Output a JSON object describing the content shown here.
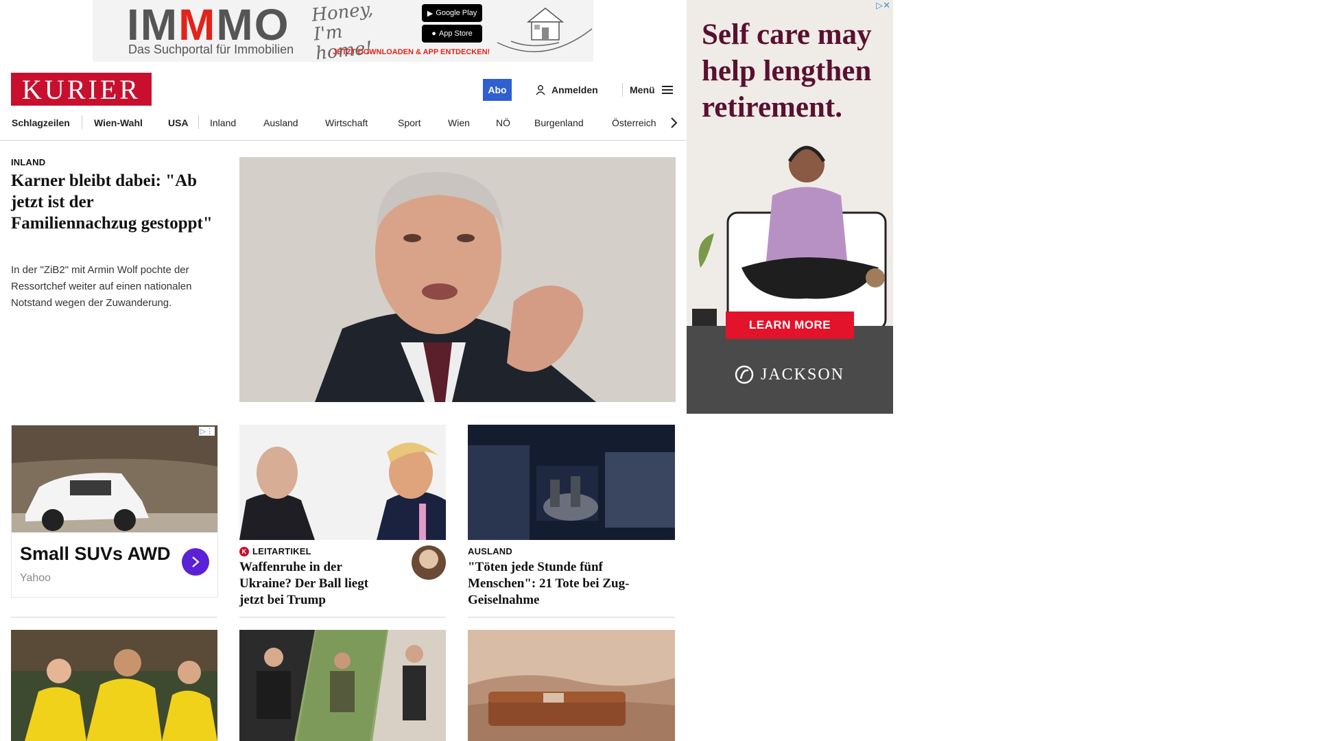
{
  "top_ad": {
    "brand_left": "IM",
    "brand_mid": "M",
    "brand_right": "MO",
    "tagline": "Das Suchportal für Immobilien",
    "script": "Honey, I'm home!",
    "google_play": "Google Play",
    "app_store": "App Store",
    "cta": "JETZT DOWNLOADEN & APP ENTDECKEN!"
  },
  "header": {
    "logo": "KURIER",
    "abo": "Abo",
    "login": "Anmelden",
    "menu": "Menü"
  },
  "nav": {
    "items": [
      "Schlagzeilen",
      "Wien-Wahl",
      "USA",
      "Inland",
      "Ausland",
      "Wirtschaft",
      "Sport",
      "Wien",
      "NÖ",
      "Burgenland",
      "Österreich"
    ]
  },
  "lead": {
    "kicker": "INLAND",
    "title": "Karner bleibt dabei: \"Ab jetzt ist der Familiennachzug gestoppt\"",
    "teaser": "In der \"ZiB2\" mit Armin Wolf pochte der Ressortchef weiter auf einen nationalen Notstand wegen der Zuwanderung."
  },
  "side_ad": {
    "headline": "Self care may help lengthen retirement.",
    "button": "LEARN MORE",
    "brand": "JACKSON"
  },
  "suv_ad": {
    "title": "Small SUVs AWD",
    "source": "Yahoo"
  },
  "articles": {
    "leitartikel": {
      "kicker": "LEITARTIKEL",
      "title": "Waffenruhe in der Ukraine? Der Ball liegt jetzt bei Trump"
    },
    "ausland": {
      "kicker": "AUSLAND",
      "title": "\"Töten jede Stunde fünf Menschen\": 21 Tote bei Zug-Geiselnahme"
    }
  },
  "colors": {
    "brand_red": "#c8102e",
    "abo_blue": "#2f5fd0",
    "ad_cta_red": "#e3132b",
    "suv_button_purple": "#5b21d6"
  }
}
